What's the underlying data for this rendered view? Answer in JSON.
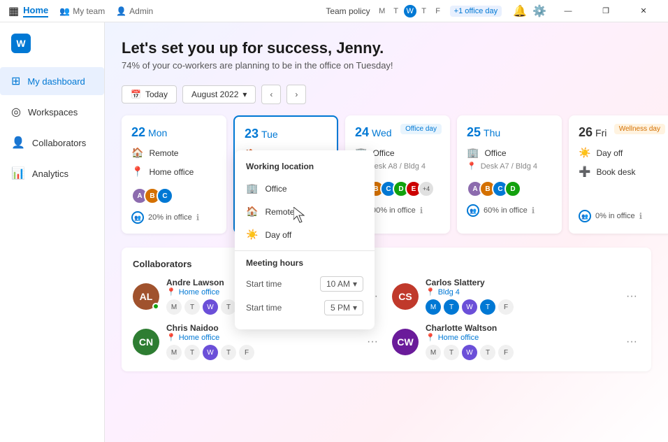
{
  "titlebar": {
    "app_icon": "▦",
    "tabs": [
      {
        "label": "Home",
        "active": true
      },
      {
        "label": "My team",
        "active": false
      },
      {
        "label": "Admin",
        "active": false
      }
    ],
    "team_policy": "Team policy",
    "days": [
      "M",
      "T",
      "W",
      "T",
      "F"
    ],
    "active_day_index": 2,
    "office_day_badge": "+1 office day",
    "win_buttons": [
      "—",
      "❐",
      "✕"
    ]
  },
  "sidebar": {
    "logo_letter": "W",
    "items": [
      {
        "label": "My dashboard",
        "icon": "⊞",
        "active": true
      },
      {
        "label": "Workspaces",
        "icon": "◎",
        "active": false
      },
      {
        "label": "Collaborators",
        "icon": "👤",
        "active": false
      },
      {
        "label": "Analytics",
        "icon": "📊",
        "active": false
      }
    ]
  },
  "main": {
    "welcome_title": "Let's set you up for success, Jenny.",
    "welcome_subtitle": "74% of your co-workers are planning to be in the office on Tuesday!",
    "today_btn": "Today",
    "month": "August 2022",
    "days": [
      {
        "number": "22",
        "name": "Mon",
        "badge": null,
        "locations": [
          "Remote",
          "Home office"
        ],
        "pct": "20% in office",
        "avatar_colors": [
          "#8c6bae",
          "#d47000",
          "#0078d4"
        ]
      },
      {
        "number": "23",
        "name": "Tue",
        "badge": null,
        "locations": [
          "Remote"
        ],
        "highlighted": true,
        "dropdown": true
      },
      {
        "number": "24",
        "name": "Wed",
        "badge": "Office day",
        "badge_type": "office",
        "locations": [
          "Office",
          "Desk A8 / Bldg 4"
        ],
        "pct": "90% in office",
        "avatar_colors": [
          "#8c6bae",
          "#d47000",
          "#0078d4",
          "#13a10e",
          "#c00"
        ],
        "avatar_extra": "+4"
      },
      {
        "number": "25",
        "name": "Thu",
        "badge": null,
        "locations": [
          "Office",
          "Desk A7 / Bldg 4"
        ],
        "pct": "60% in office",
        "avatar_colors": [
          "#8c6bae",
          "#d47000",
          "#0078d4",
          "#13a10e"
        ]
      },
      {
        "number": "26",
        "name": "Fri",
        "badge": "Wellness day",
        "badge_type": "wellness",
        "locations": [
          "Day off",
          "Book desk"
        ],
        "pct": "0% in office"
      }
    ],
    "dropdown": {
      "title": "Working location",
      "items": [
        {
          "icon": "🏢",
          "label": "Office"
        },
        {
          "icon": "🏠",
          "label": "Remote"
        },
        {
          "icon": "☀️",
          "label": "Day off"
        }
      ],
      "meeting_hours": "Meeting hours",
      "start_label": "Start time",
      "start_time": "10 AM",
      "end_label": "Start time",
      "end_time": "5 PM"
    },
    "collaborators": {
      "title": "Collaborators",
      "list": [
        {
          "name": "Andre Lawson",
          "location": "Home office",
          "avatar_color": "#a0522d",
          "days": [
            "M",
            "T",
            "W",
            "T",
            "F"
          ],
          "active_days": [
            2
          ]
        },
        {
          "name": "Carlos Slattery",
          "location": "Bldg 4",
          "avatar_color": "#c0392b",
          "days": [
            "M",
            "T",
            "W",
            "T",
            "F"
          ],
          "active_days": [
            0,
            1,
            2,
            3
          ]
        },
        {
          "name": "Chris Naidoo",
          "location": "Home office",
          "avatar_color": "#2e7d32",
          "days": [
            "M",
            "T",
            "W",
            "T",
            "F"
          ],
          "active_days": [
            2
          ]
        },
        {
          "name": "Charlotte Waltson",
          "location": "Home office",
          "avatar_color": "#6a1b9a",
          "days": [
            "M",
            "T",
            "W",
            "T",
            "F"
          ],
          "active_days": [
            2
          ]
        }
      ]
    }
  }
}
